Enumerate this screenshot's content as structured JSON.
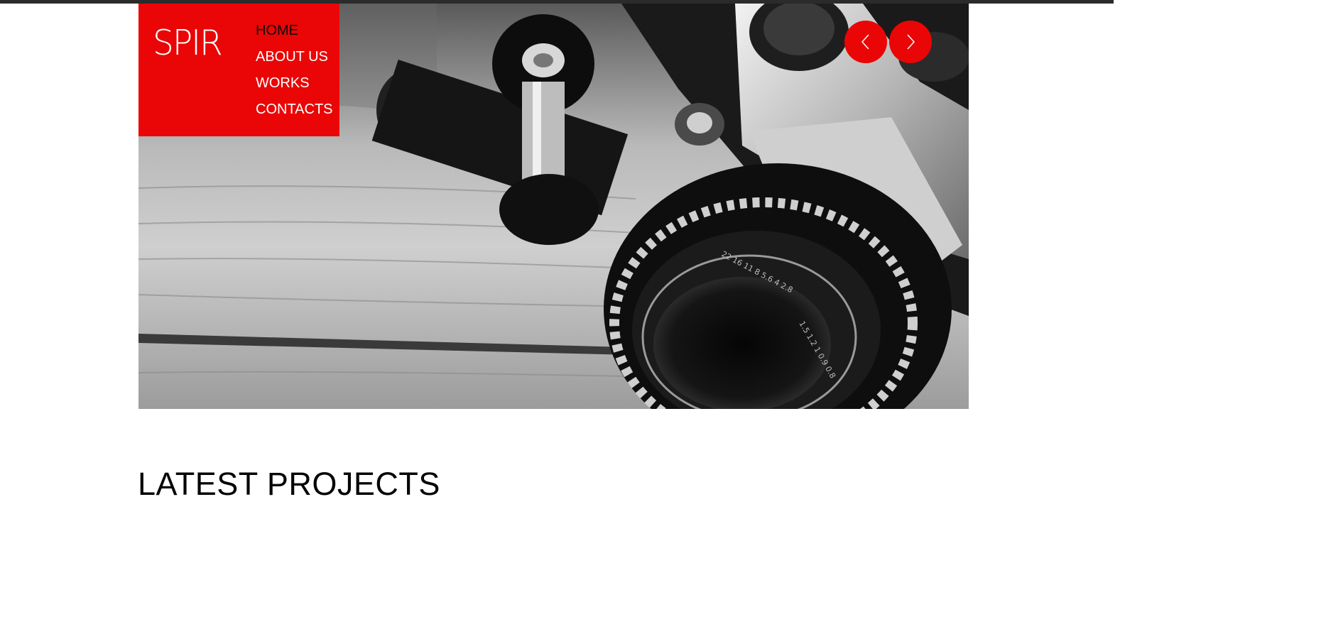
{
  "site": {
    "logo_text": "SPIR"
  },
  "nav": {
    "items": [
      {
        "label": "HOME",
        "active": true
      },
      {
        "label": "ABOUT US",
        "active": false
      },
      {
        "label": "WORKS",
        "active": false
      },
      {
        "label": "CONTACTS",
        "active": false
      }
    ]
  },
  "slider": {
    "image_subject": "vintage camera and film spool on wooden table (black & white)",
    "prev_icon": "chevron-left-icon",
    "next_icon": "chevron-right-icon"
  },
  "sections": {
    "latest_projects_title": "LATEST PROJECTS"
  },
  "colors": {
    "accent": "#ea0606",
    "text_dark": "#050505",
    "top_bar": "#2b2b2b"
  }
}
